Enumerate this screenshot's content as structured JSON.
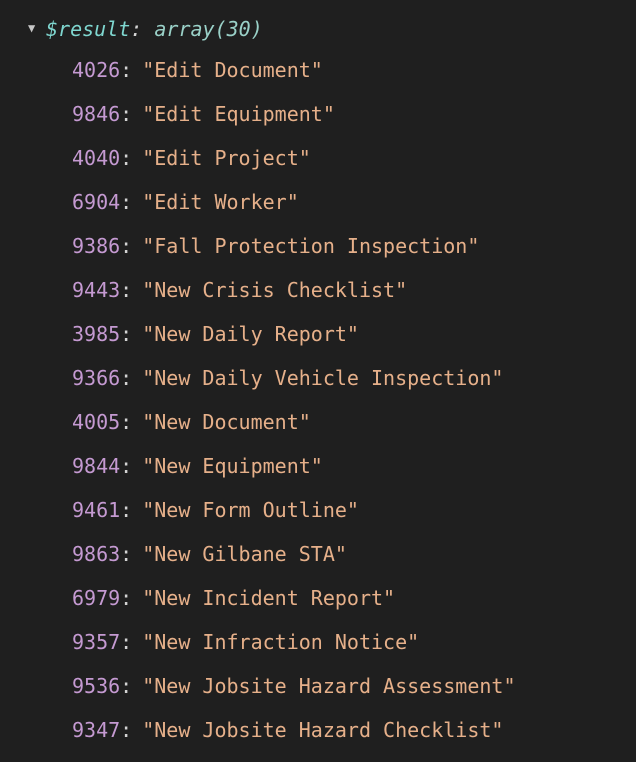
{
  "root": {
    "var_name": "$result",
    "type_label": "array(30)"
  },
  "entries": [
    {
      "key": "4026",
      "value": "\"Edit Document\""
    },
    {
      "key": "9846",
      "value": "\"Edit Equipment\""
    },
    {
      "key": "4040",
      "value": "\"Edit Project\""
    },
    {
      "key": "6904",
      "value": "\"Edit Worker\""
    },
    {
      "key": "9386",
      "value": "\"Fall Protection Inspection\""
    },
    {
      "key": "9443",
      "value": "\"New Crisis Checklist\""
    },
    {
      "key": "3985",
      "value": "\"New Daily Report\""
    },
    {
      "key": "9366",
      "value": "\"New Daily Vehicle Inspection\""
    },
    {
      "key": "4005",
      "value": "\"New Document\""
    },
    {
      "key": "9844",
      "value": "\"New Equipment\""
    },
    {
      "key": "9461",
      "value": "\"New Form Outline\""
    },
    {
      "key": "9863",
      "value": "\"New Gilbane STA\""
    },
    {
      "key": "6979",
      "value": "\"New Incident Report\""
    },
    {
      "key": "9357",
      "value": "\"New Infraction Notice\""
    },
    {
      "key": "9536",
      "value": "\"New Jobsite Hazard Assessment\""
    },
    {
      "key": "9347",
      "value": "\"New Jobsite Hazard Checklist\""
    }
  ]
}
